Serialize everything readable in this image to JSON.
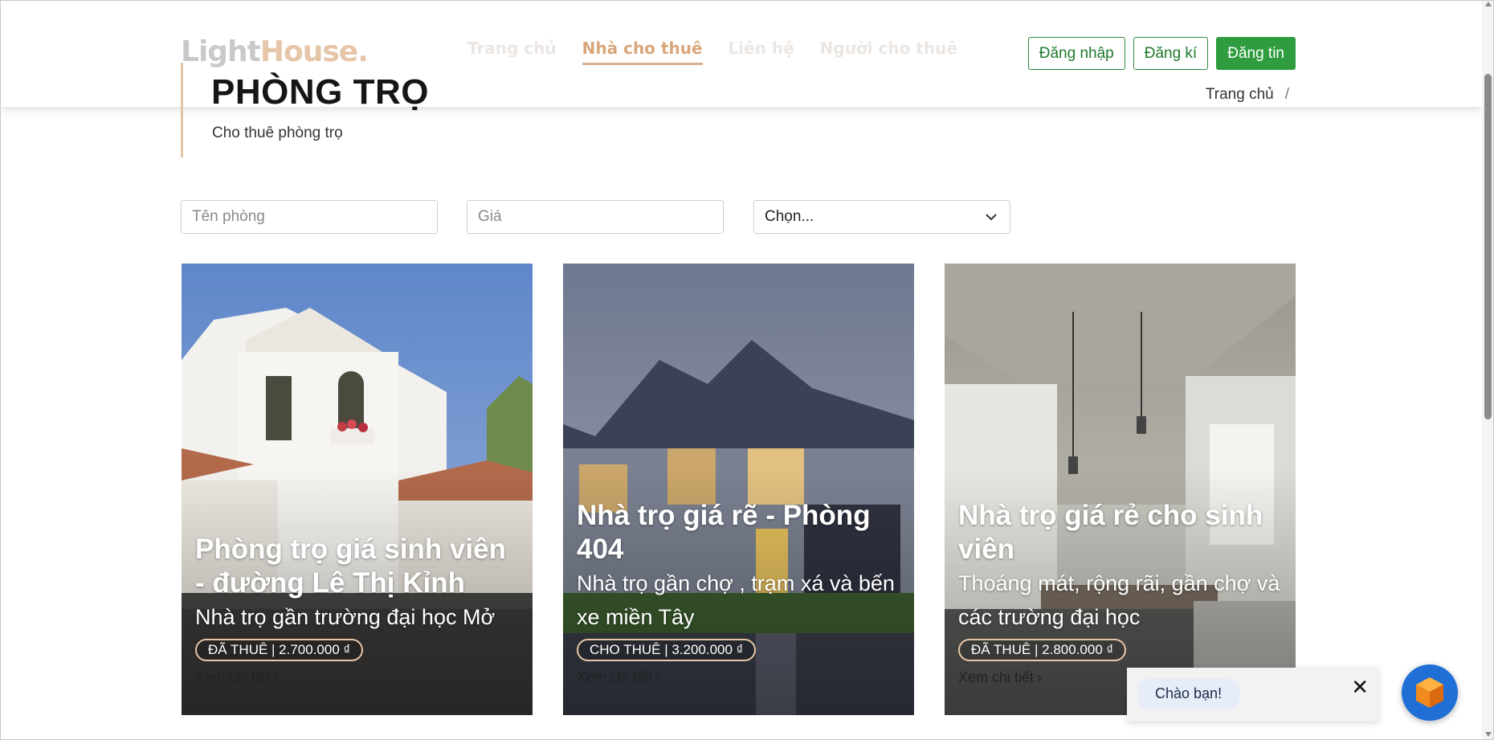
{
  "header": {
    "logo_part1": "Light",
    "logo_part2": "House.",
    "nav": [
      {
        "label": "Trang chủ",
        "active": false
      },
      {
        "label": "Nhà cho thuê",
        "active": true
      },
      {
        "label": "Liên hệ",
        "active": false
      },
      {
        "label": "Người cho thuê",
        "active": false
      }
    ],
    "auth": {
      "login": "Đăng nhập",
      "register": "Đăng kí",
      "post": "Đăng tin"
    },
    "breadcrumb": {
      "home": "Trang chủ",
      "separator": "/"
    }
  },
  "page": {
    "title": "PHÒNG TRỌ",
    "subtitle": "Cho thuê phòng trọ"
  },
  "filters": {
    "name_placeholder": "Tên phòng",
    "price_placeholder": "Giá",
    "select_value": "Chọn..."
  },
  "cards": [
    {
      "title": "Phòng trọ giá sinh viên - đường Lê Thị Kỉnh",
      "desc": "Nhà trọ gần trường đại học Mở",
      "badge": "ĐÃ THUÊ | 2.700.000 ₫",
      "link": "Xem chi tiết"
    },
    {
      "title": "Nhà trọ giá rẽ - Phòng 404",
      "desc": "Nhà trọ gần chợ , trạm xá và bến xe miền Tây",
      "badge": "CHO THUÊ | 3.200.000 ₫",
      "link": "Xem chi tiết"
    },
    {
      "title": "Nhà trọ giá rẻ cho sinh viên",
      "desc": "Thoáng mát, rộng rãi, gần chợ và các trường đại học",
      "badge": "ĐÃ THUÊ | 2.800.000 ₫",
      "link": "Xem chi tiết"
    }
  ],
  "chat": {
    "greeting": "Chào bạn!",
    "close_symbol": "✕"
  },
  "colors": {
    "accent": "#d9a67a",
    "primary_green": "#2f9d3f",
    "chat_blue": "#1f6fd6"
  }
}
